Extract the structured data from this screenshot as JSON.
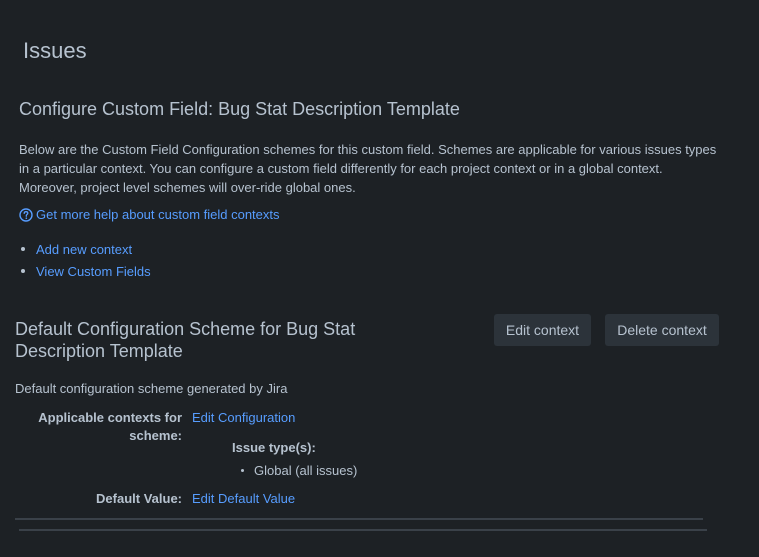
{
  "page": {
    "title": "Issues",
    "subtitle": "Configure Custom Field: Bug Stat Description Template",
    "description": "Below are the Custom Field Configuration schemes for this custom field. Schemes are applicable for various issues types in a particular context. You can configure a custom field differently for each project context or in a global context. Moreover, project level schemes will over-ride global ones.",
    "help_link": "Get more help about custom field contexts",
    "actions": [
      {
        "label": "Add new context"
      },
      {
        "label": "View Custom Fields"
      }
    ]
  },
  "scheme": {
    "title": "Default Configuration Scheme for Bug Stat Description Template",
    "edit_button": "Edit context",
    "delete_button": "Delete context",
    "description": "Default configuration scheme generated by Jira",
    "contexts_label": "Applicable contexts for scheme:",
    "edit_configuration": "Edit Configuration",
    "issue_types_label": "Issue type(s):",
    "issue_types": [
      "Global (all issues)"
    ],
    "default_value_label": "Default Value:",
    "edit_default_value": "Edit Default Value"
  },
  "colors": {
    "background": "#1d2125",
    "text": "#b6c2cf",
    "link": "#579dff",
    "button_bg": "#2c333a"
  },
  "icons": {
    "help": "question-circle-icon"
  }
}
